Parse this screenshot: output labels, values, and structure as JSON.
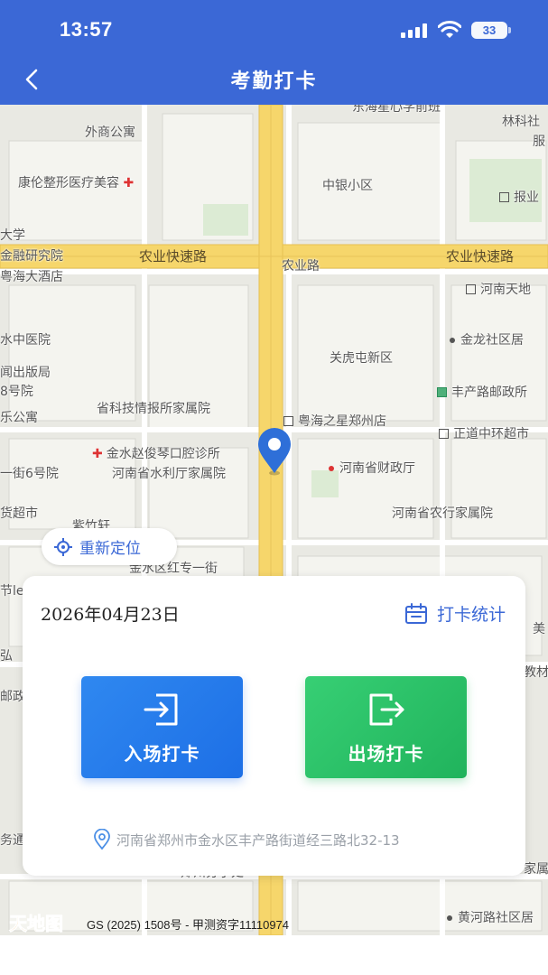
{
  "status_bar": {
    "time": "13:57",
    "battery": "33"
  },
  "header": {
    "title": "考勤打卡"
  },
  "map": {
    "labels": [
      "东海星心学前班",
      "外商公寓",
      "林科社",
      "服",
      "康伦整形医疗美容",
      "中银小区",
      "报业",
      "大学",
      "金融研究院",
      "农业快速路",
      "农业路",
      "农业快速路",
      "粤海大酒店",
      "河南天地",
      "水中医院",
      "关虎屯新区",
      "金龙社区居",
      "闻出版局",
      "8号院",
      "丰产路邮政所",
      "乐公寓",
      "省科技情报所家属院",
      "粤海之星郑州店",
      "正道中环超市",
      "金水赵俊琴口腔诊所",
      "河南省水利厅家属院",
      "河南省财政厅",
      "一街6号院",
      "货超市",
      "紫竹轩",
      "河南省农行家属院",
      "金水区红专一街",
      "节le",
      "美",
      "弘",
      "教材",
      "邮政",
      "务通",
      "郑州分子处",
      "家属",
      "黄河路社区居"
    ]
  },
  "relocate_label": "重新定位",
  "card": {
    "date": "2026年04月23日",
    "stats_label": "打卡统计",
    "punch_in_label": "入场打卡",
    "punch_out_label": "出场打卡",
    "address": "河南省郑州市金水区丰产路街道经三路北32-13"
  },
  "footer": {
    "logo_text": "天地图",
    "copyright": "GS (2025) 1508号 - 甲测资字11110974",
    "poi": "黄河路社区居"
  },
  "colors": {
    "brand_blue": "#3B68D6",
    "punch_in": "#2F88F0",
    "punch_out": "#28BD63",
    "road_yellow": "#F6D66B"
  }
}
